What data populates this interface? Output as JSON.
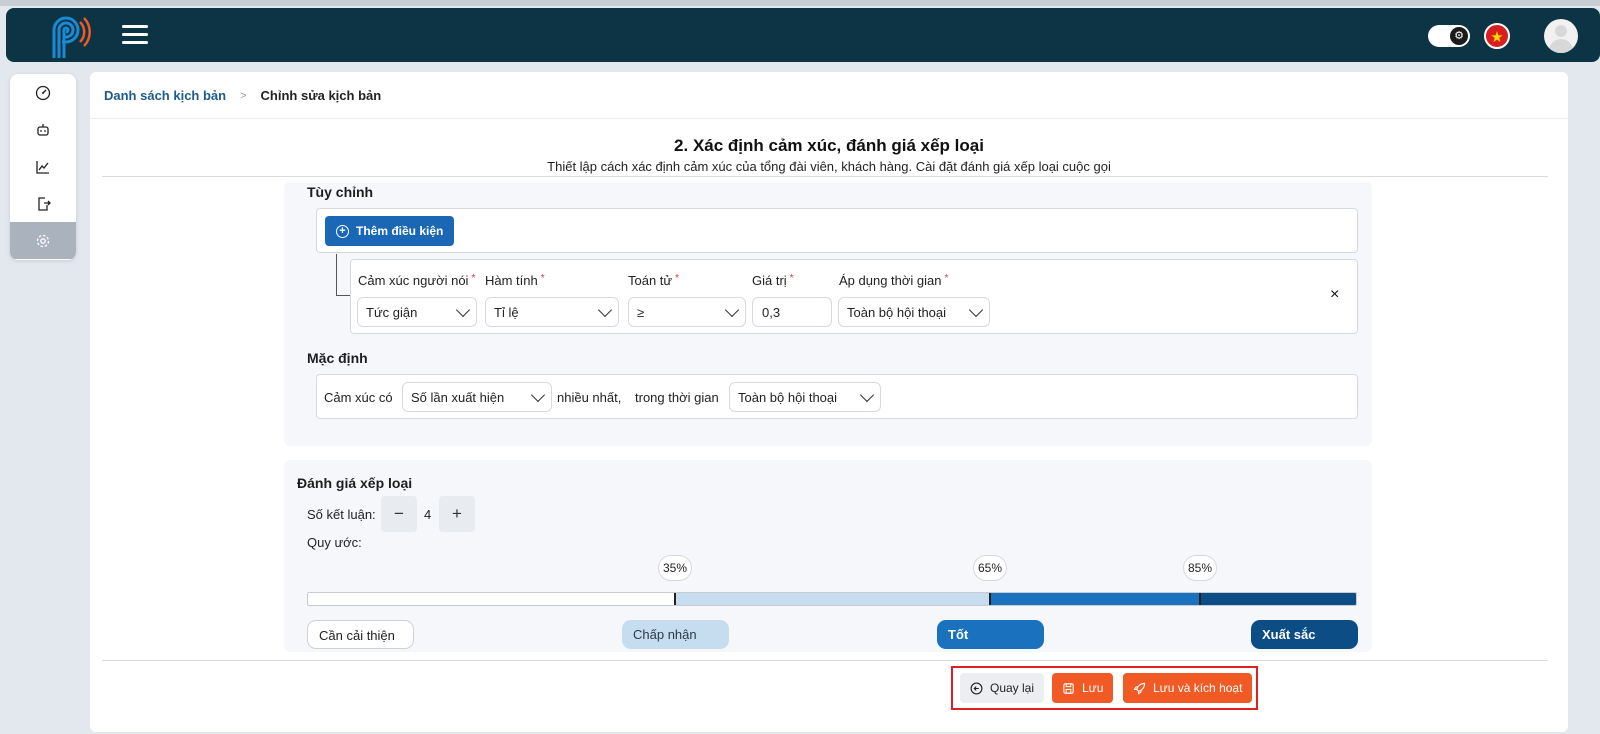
{
  "topbar": {
    "logo": "p-signal-logo",
    "theme_icon": "gear-icon",
    "language_flag": "vietnam-flag-icon",
    "avatar": "user-avatar"
  },
  "sidebar": {
    "items": [
      {
        "icon": "dashboard-gauge-icon"
      },
      {
        "icon": "robot-icon"
      },
      {
        "icon": "line-chart-icon"
      },
      {
        "icon": "file-export-icon"
      },
      {
        "icon": "settings-gear-icon",
        "active": true
      }
    ]
  },
  "breadcrumb": {
    "parent": "Danh sách kịch bản",
    "current": "Chỉnh sửa kịch bản"
  },
  "step": {
    "title": "2. Xác định cảm xúc, đánh giá xếp loại",
    "subtitle": "Thiết lập cách xác định cảm xúc của tổng đài viên, khách hàng. Cài đặt đánh giá xếp loại cuộc gọi"
  },
  "custom": {
    "label": "Tùy chỉnh",
    "add_button": "Thêm điều kiện",
    "condition": {
      "speaker_label": "Cảm xúc người nói",
      "speaker_value": "Tức giận",
      "function_label": "Hàm tính",
      "function_value": "Tỉ lệ",
      "operator_label": "Toán tử",
      "operator_value": "≥",
      "value_label": "Giá trị",
      "value_value": "0,3",
      "time_label": "Áp dụng thời gian",
      "time_value": "Toàn bộ hội thoại",
      "required_mark": "*",
      "remove": "×"
    }
  },
  "default": {
    "label": "Mặc định",
    "prefix": "Cảm xúc có",
    "metric_value": "Số lần xuất hiện",
    "middle": "nhiều nhất,",
    "time_prefix": "trong thời gian",
    "time_value": "Toàn bộ hội thoại"
  },
  "grading": {
    "title": "Đánh giá xếp loại",
    "count_label": "Số kết luận:",
    "minus": "−",
    "count": "4",
    "plus": "+",
    "convention_label": "Quy ước:",
    "thresholds": [
      {
        "label": "35%",
        "value": 35
      },
      {
        "label": "65%",
        "value": 65
      },
      {
        "label": "85%",
        "value": 85
      }
    ],
    "grades": [
      {
        "label": "Cần cải thiện",
        "color": "#ffffff"
      },
      {
        "label": "Chấp nhận",
        "color": "#c6dcef"
      },
      {
        "label": "Tốt",
        "color": "#1a72bf"
      },
      {
        "label": "Xuất sắc",
        "color": "#0c4d86"
      }
    ]
  },
  "actions": {
    "back": "Quay lại",
    "save": "Lưu",
    "save_activate": "Lưu và kích hoạt",
    "accent": "#f15a24"
  }
}
